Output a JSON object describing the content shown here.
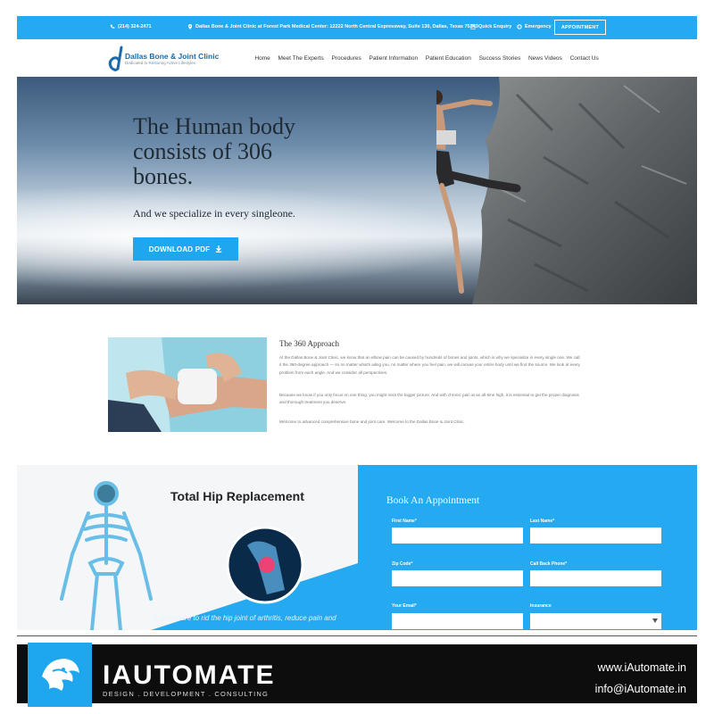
{
  "topbar": {
    "phone": "(214) 324-2471",
    "address": "Dallas Bone & Joint Clinic at Forest Park Medical Center: 12222 North Central Expressway, Suite 130, Dallas, Texas 75243",
    "quick_enquiry": "Quick Enquiry",
    "emergency": "Emergency",
    "appointment": "APPOINTMENT"
  },
  "logo": {
    "name": "Dallas Bone & Joint Clinic",
    "tagline": "Dedicated to Restoring Active Lifestyles"
  },
  "nav": [
    "Home",
    "Meet The Experts",
    "Procedures",
    "Patient Information",
    "Patient Education",
    "Success Stories",
    "News Videos",
    "Contact Us"
  ],
  "hero": {
    "headline_1": "The Human body",
    "headline_2": "consists of 306",
    "headline_3": "bones.",
    "subheadline": "And we specialize in every singleone.",
    "cta": "DOWNLOAD PDF"
  },
  "approach": {
    "title": "The 360 Approach",
    "p1": "At the Dallas Bone & Joint Clinic, we know that an elbow pain can be caused by hundreds of bones and joints, which is why we specialize in every single one. We call it the 360-degree approach — so no matter what's ailing you, no matter where you feel pain, we will canvas your entire body until we find the source. We look at every problem from each angle. And we consider all perspectives.",
    "p2": "Because we know if you only focus on one thing, you might miss the bigger picture. And with chronic pain at an all-time high, it is essential to get the proper diagnosis and thorough treatment you deserve.",
    "p3": "Welcome to advanced comprehensive bone and joint care. Welcome to the Dallas Bone & Joint Clinic."
  },
  "hip": {
    "title": "Total Hip Replacement",
    "description": "A procedure to rid the hip joint of arthritis, reduce pain and"
  },
  "booking": {
    "title": "Book An Appointment",
    "first_name": "First Name*",
    "last_name": "Last Name*",
    "zip_code": "Zip Code*",
    "call_back_phone": "Call Back Phone*",
    "your_email": "Your Email*",
    "insurance": "Insurance"
  },
  "brand": {
    "name": "IAUTOMATE",
    "tagline": "DESIGN . DEVELOPMENT . CONSULTING",
    "website": "www.iAutomate.in",
    "email": "info@iAutomate.in"
  },
  "colors": {
    "accent": "#25a9f1",
    "footer_bg": "#0d0d0d",
    "logo_blue": "#1c6aa9"
  }
}
